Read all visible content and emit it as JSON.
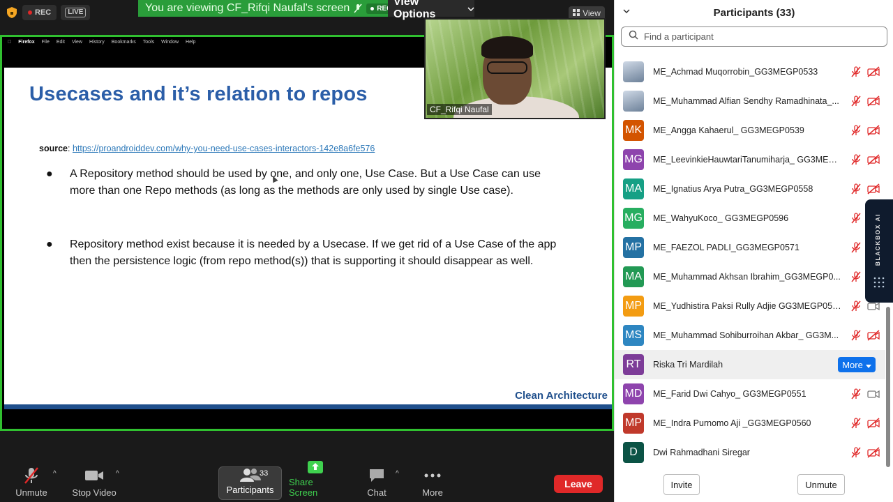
{
  "status": {
    "rec_label": "REC",
    "live_label": "LIVE"
  },
  "banner": {
    "text": "You are viewing CF_Rifqi Naufal's screen",
    "rec_label": "REC",
    "view_options": "View Options"
  },
  "view_button": "View",
  "mac_menu": [
    "Firefox",
    "File",
    "Edit",
    "View",
    "History",
    "Bookmarks",
    "Tools",
    "Window",
    "Help"
  ],
  "slide": {
    "title": "Usecases and it’s relation to repos",
    "source_label": "source",
    "source_url": "https://proandroiddev.com/why-you-need-use-cases-interactors-142e8a6fe576",
    "bullets": [
      "A Repository method should be used by one, and only one, Use Case. But a Use Case can use more than one Repo methods (as long as the methods are only used by single Use case).",
      "Repository method exist because it is needed by a Usecase. If we get rid of a Use Case of the app then the persistence logic (from repo method(s)) that is supporting it should disappear as well."
    ],
    "footer": "Clean Architecture"
  },
  "video": {
    "name": "CF_Rifqi Naufal"
  },
  "toolbar": {
    "unmute": "Unmute",
    "stop_video": "Stop Video",
    "participants": "Participants",
    "participants_count": "33",
    "share_screen": "Share Screen",
    "chat": "Chat",
    "more": "More",
    "leave": "Leave"
  },
  "panel": {
    "title": "Participants (33)",
    "search_placeholder": "Find a participant",
    "participants": [
      {
        "initials": "",
        "name": "ME_Achmad Muqorrobin_GG3MEGP0533",
        "color": "photo",
        "mic": "muted",
        "cam": "off"
      },
      {
        "initials": "",
        "name": "ME_Muhammad Alfian Sendhy Ramadhinata_...",
        "color": "photo",
        "mic": "muted",
        "cam": "off"
      },
      {
        "initials": "MK",
        "name": "ME_Angga Kahaerul_ GG3MEGP0539",
        "color": "#d35400",
        "mic": "muted",
        "cam": "off"
      },
      {
        "initials": "MG",
        "name": "ME_LeevinkieHauwtariTanumiharja_ GG3MEG...",
        "color": "#8e44ad",
        "mic": "muted",
        "cam": "off"
      },
      {
        "initials": "MA",
        "name": "ME_Ignatius Arya Putra_GG3MEGP0558",
        "color": "#16a085",
        "mic": "muted",
        "cam": "off"
      },
      {
        "initials": "MG",
        "name": "ME_WahyuKoco_ GG3MEGP0596",
        "color": "#27ae60",
        "mic": "muted",
        "cam": "off"
      },
      {
        "initials": "MP",
        "name": "ME_FAEZOL PADLI_GG3MEGP0571",
        "color": "#2471a3",
        "mic": "muted",
        "cam": "off"
      },
      {
        "initials": "MA",
        "name": "ME_Muhammad Akhsan Ibrahim_GG3MEGP0...",
        "color": "#229954",
        "mic": "muted",
        "cam": "off"
      },
      {
        "initials": "MP",
        "name": "ME_Yudhistira Paksi Rully Adjie GG3MEGP0599",
        "color": "#f39c12",
        "mic": "muted",
        "cam": "on"
      },
      {
        "initials": "MS",
        "name": "ME_Muhammad Sohiburroihan Akbar_ GG3M...",
        "color": "#2e86c1",
        "mic": "muted",
        "cam": "off"
      },
      {
        "initials": "RT",
        "name": "Riska Tri Mardilah",
        "color": "#7d3c98",
        "mic": "none",
        "cam": "none",
        "more": "More"
      },
      {
        "initials": "MD",
        "name": "ME_Farid Dwi Cahyo_ GG3MEGP0551",
        "color": "#8e44ad",
        "mic": "muted",
        "cam": "on"
      },
      {
        "initials": "MP",
        "name": "ME_Indra Purnomo Aji _GG3MEGP0560",
        "color": "#c0392b",
        "mic": "muted",
        "cam": "off"
      },
      {
        "initials": "D",
        "name": "Dwi Rahmadhani Siregar",
        "color": "#0b5345",
        "mic": "muted",
        "cam": "off"
      }
    ],
    "invite": "Invite",
    "unmute_me": "Unmute"
  },
  "blackbox": {
    "label": "BLACKBOX AI"
  }
}
